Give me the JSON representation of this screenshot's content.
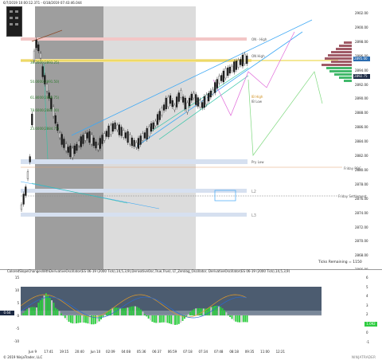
{
  "header": {
    "date_range": "6/7/2019 10:00:12.371 - 6/18/2019 07:43:46.044"
  },
  "price_axis": {
    "labels": [
      "2902.00",
      "2900.00",
      "2898.00",
      "2896.00",
      "2894.00",
      "2892.00",
      "2890.00",
      "2888.00",
      "2886.00",
      "2884.00",
      "2882.00",
      "2880.00",
      "2878.00",
      "2876.00",
      "2874.00",
      "2872.00",
      "2870.00",
      "2868.00",
      "2866.00"
    ],
    "current_price_tag": "2895.00",
    "second_price_tag": "2892.75"
  },
  "levels": {
    "on_high": "ON - High",
    "on_high2": "ON High",
    "on_low": "ON Low",
    "ib_high": "IB High",
    "ib_low": "IB Low",
    "prior_low": "Pry Low",
    "friday_poc": "Friday POC",
    "friday_settle": "Friday Settlement",
    "l2": "L2",
    "l3": "L3"
  },
  "fib_labels": [
    "38.2000(2893.25)",
    "50.0000(2891.50)",
    "61.8000(2889.75)",
    "78.6000(2887.00)",
    "23.6000(2884.75)"
  ],
  "ticks_remaining": "Ticks Remaining = 1150",
  "indicator": {
    "title": "ColoredSlopeChangesWithDerivativeOscillator(ES 06-19 (2000 Tick),14,5,3,9),DerivativeOsc,True,True), LT_Zerolag_Oscillator, DerivativeOscillator(ES 06-19 (2000 Tick),14,5,3,9)",
    "left_axis": [
      "15",
      "10",
      "5",
      "0",
      "-5",
      "-10"
    ],
    "right_axis": [
      "6",
      "5",
      "4",
      "3",
      "2",
      "1",
      "0",
      "-1"
    ],
    "left_value_tag": "0.64",
    "right_value_tag": "1.092"
  },
  "time_axis": [
    "Jun 9",
    "17:41",
    "19:15",
    "20:40",
    "Jun 10",
    "02:09",
    "04:08",
    "05:36",
    "06:37",
    "06:59",
    "07:18",
    "07:34",
    "07:48",
    "08:18",
    "09:35",
    "11:00",
    "12:21"
  ],
  "footer": {
    "copyright": "© 2019 NinjaTrader, LLC",
    "logo": "NINJATRADER"
  },
  "colors": {
    "candle_up": "#1a1a1a",
    "wick": "#333333",
    "channel_line": "#3fa9f5",
    "pitchfork": "#2ec4a5",
    "projection": "#7fd97f",
    "projection_pink": "#e066d9",
    "price_tag": "#2b6cb0",
    "yellow_line": "#e8d02c",
    "volume_profile": "#a05a66",
    "volume_profile_green": "#42b96b",
    "osc_green": "#2ecc40",
    "osc_white": "#d0d0d0",
    "session_grey": "#bdbdbd"
  }
}
